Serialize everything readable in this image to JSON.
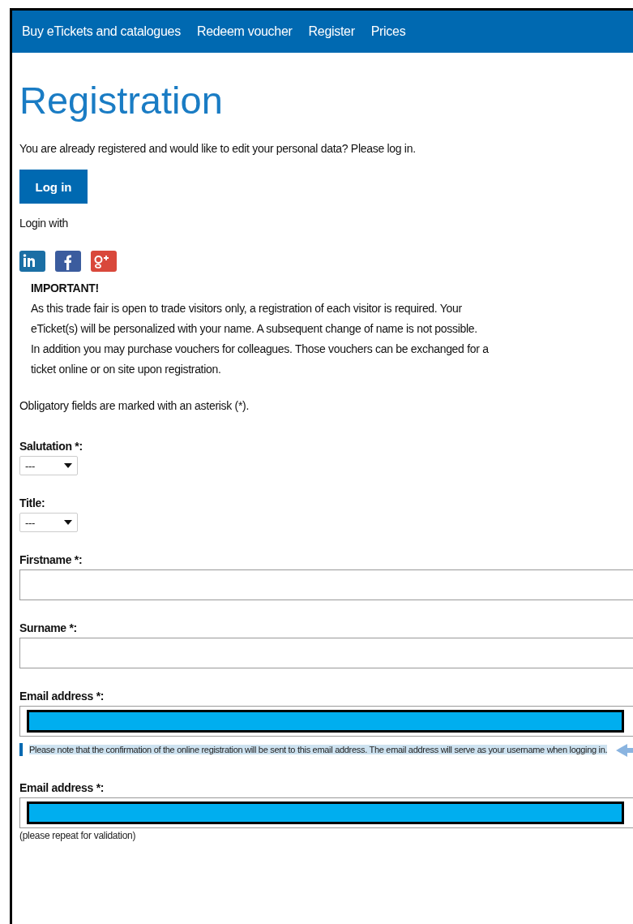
{
  "nav": {
    "items": [
      {
        "label": "Buy eTickets and catalogues"
      },
      {
        "label": "Redeem voucher"
      },
      {
        "label": "Register"
      },
      {
        "label": "Prices"
      }
    ]
  },
  "heading": "Registration",
  "intro": "You are already registered and would like to edit your personal data? Please log in.",
  "login_button": "Log in",
  "login_with": "Login with",
  "social": [
    {
      "kind": "linkedin"
    },
    {
      "kind": "facebook"
    },
    {
      "kind": "googleplus"
    }
  ],
  "important": {
    "title": "IMPORTANT!",
    "lines": [
      "As this trade fair is open to trade visitors only, a registration of each visitor is required. Your eTicket(s) will be personalized with your name. A subsequent change of name is not possible.",
      "In addition you may purchase vouchers for colleagues. Those vouchers can be exchanged for a ticket online or on site upon registration."
    ]
  },
  "obligatory_note": "Obligatory fields are marked with an asterisk (*).",
  "fields": [
    {
      "kind": "select",
      "label": "Salutation *:",
      "value": "---"
    },
    {
      "kind": "select",
      "label": "Title:",
      "value": "---"
    },
    {
      "kind": "text",
      "label": "Firstname *:"
    },
    {
      "kind": "text",
      "label": "Surname *:"
    },
    {
      "kind": "text",
      "label": "Email address *:",
      "redacted": true,
      "note": {
        "text": "Please note that the confirmation of the online registration will be sent to this email address. The email address will serve as your username when logging in.",
        "highlighted": true
      }
    },
    {
      "kind": "text",
      "label": "Email address *:",
      "redacted": true,
      "hint": "(please repeat for validation)"
    }
  ]
}
